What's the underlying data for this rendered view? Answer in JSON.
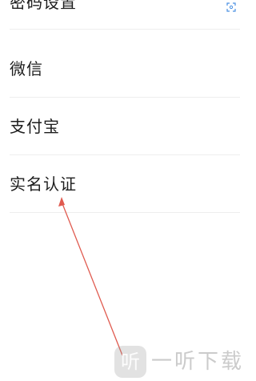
{
  "settings_list": {
    "items": [
      {
        "label": "密码设置"
      },
      {
        "label": "微信"
      },
      {
        "label": "支付宝"
      },
      {
        "label": "实名认证"
      }
    ]
  },
  "corner_icon": {
    "icon": "scan-icon",
    "color": "#4a90e2"
  },
  "annotation": {
    "icon": "arrow-icon",
    "color": "#e05a4f"
  },
  "watermark": {
    "badge_text": "听",
    "text": "一听下载"
  }
}
